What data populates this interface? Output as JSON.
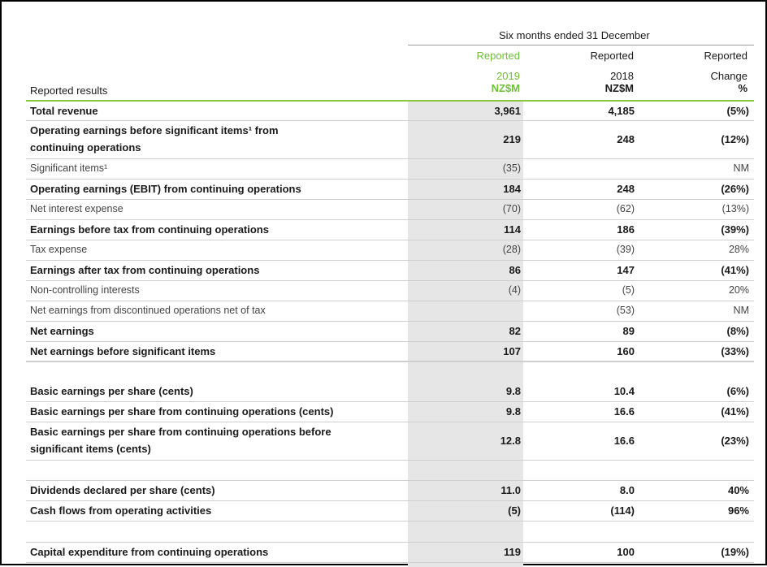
{
  "header": {
    "period": "Six months ended 31 December",
    "col2019": {
      "line1": "Reported",
      "line2": "2019",
      "line3": "NZ$M"
    },
    "col2018": {
      "line1": "Reported",
      "line2": "2018",
      "line3": "NZ$M"
    },
    "colChange": {
      "line1": "Reported",
      "line2": "Change",
      "line3": "%"
    },
    "section_label": "Reported results"
  },
  "colors": {
    "accent": "#8cc63f",
    "shade": "#e6e6e6"
  },
  "rows": [
    {
      "label": "Total revenue",
      "v2019": "3,961",
      "v2018": "4,185",
      "change": "(5%)",
      "style": "bold"
    },
    {
      "label": "Operating earnings before significant items¹ from",
      "label2": "continuing operations",
      "v2019": "219",
      "v2018": "248",
      "change": "(12%)",
      "style": "bold"
    },
    {
      "label": "Significant items¹",
      "v2019": "(35)",
      "v2018": "",
      "change": "NM",
      "style": "light"
    },
    {
      "label": "Operating earnings (EBIT) from continuing operations",
      "v2019": "184",
      "v2018": "248",
      "change": "(26%)",
      "style": "bold"
    },
    {
      "label": "Net interest expense",
      "v2019": "(70)",
      "v2018": "(62)",
      "change": "(13%)",
      "style": "light"
    },
    {
      "label": "Earnings before tax from continuing operations",
      "v2019": "114",
      "v2018": "186",
      "change": "(39%)",
      "style": "bold"
    },
    {
      "label": "Tax expense",
      "v2019": "(28)",
      "v2018": "(39)",
      "change": "28%",
      "style": "light"
    },
    {
      "label": "Earnings after tax from continuing operations",
      "v2019": "86",
      "v2018": "147",
      "change": "(41%)",
      "style": "bold"
    },
    {
      "label": "Non-controlling interests",
      "v2019": "(4)",
      "v2018": "(5)",
      "change": "20%",
      "style": "light"
    },
    {
      "label": "Net earnings from discontinued operations net of tax",
      "v2019": "",
      "v2018": "(53)",
      "change": "NM",
      "style": "light"
    },
    {
      "label": "Net earnings",
      "v2019": "82",
      "v2018": "89",
      "change": "(8%)",
      "style": "bold"
    },
    {
      "label": "Net earnings before significant items",
      "v2019": "107",
      "v2018": "160",
      "change": "(33%)",
      "style": "bold"
    },
    {
      "label": "Basic earnings per share (cents)",
      "v2019": "9.8",
      "v2018": "10.4",
      "change": "(6%)",
      "style": "bold"
    },
    {
      "label": "Basic earnings per share from continuing operations (cents)",
      "v2019": "9.8",
      "v2018": "16.6",
      "change": "(41%)",
      "style": "bold"
    },
    {
      "label": "Basic earnings per share from continuing operations before",
      "label2": "significant items (cents)",
      "v2019": "12.8",
      "v2018": "16.6",
      "change": "(23%)",
      "style": "bold"
    },
    {
      "label": "Dividends declared per share (cents)",
      "v2019": "11.0",
      "v2018": "8.0",
      "change": "40%",
      "style": "bold"
    },
    {
      "label": "Cash flows from operating activities",
      "v2019": "(5)",
      "v2018": "(114)",
      "change": "96%",
      "style": "bold"
    },
    {
      "label": "Capital expenditure from continuing operations",
      "v2019": "119",
      "v2018": "100",
      "change": "(19%)",
      "style": "bold"
    }
  ]
}
